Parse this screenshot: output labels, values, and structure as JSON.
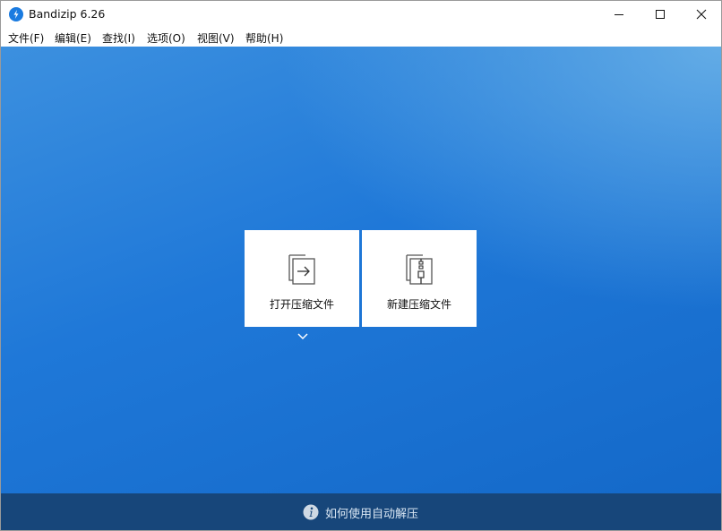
{
  "window": {
    "title": "Bandizip 6.26",
    "controls": {
      "minimize_icon": "minimize-icon",
      "maximize_icon": "maximize-icon",
      "close_icon": "close-icon"
    }
  },
  "menu": {
    "items": [
      {
        "label": "文件(F)"
      },
      {
        "label": "编辑(E)"
      },
      {
        "label": "查找(I)"
      },
      {
        "label": "选项(O)"
      },
      {
        "label": "视图(V)"
      },
      {
        "label": "帮助(H)"
      }
    ]
  },
  "main": {
    "tiles": [
      {
        "label": "打开压缩文件",
        "icon": "open-archive-icon"
      },
      {
        "label": "新建压缩文件",
        "icon": "new-archive-icon"
      }
    ],
    "dropdown_icon": "chevron-down-icon"
  },
  "footer": {
    "text": "如何使用自动解压",
    "icon": "info-icon"
  },
  "colors": {
    "accent": "#1a7be0",
    "main_background": "#1f78d8",
    "footer_background": "#17467a"
  }
}
